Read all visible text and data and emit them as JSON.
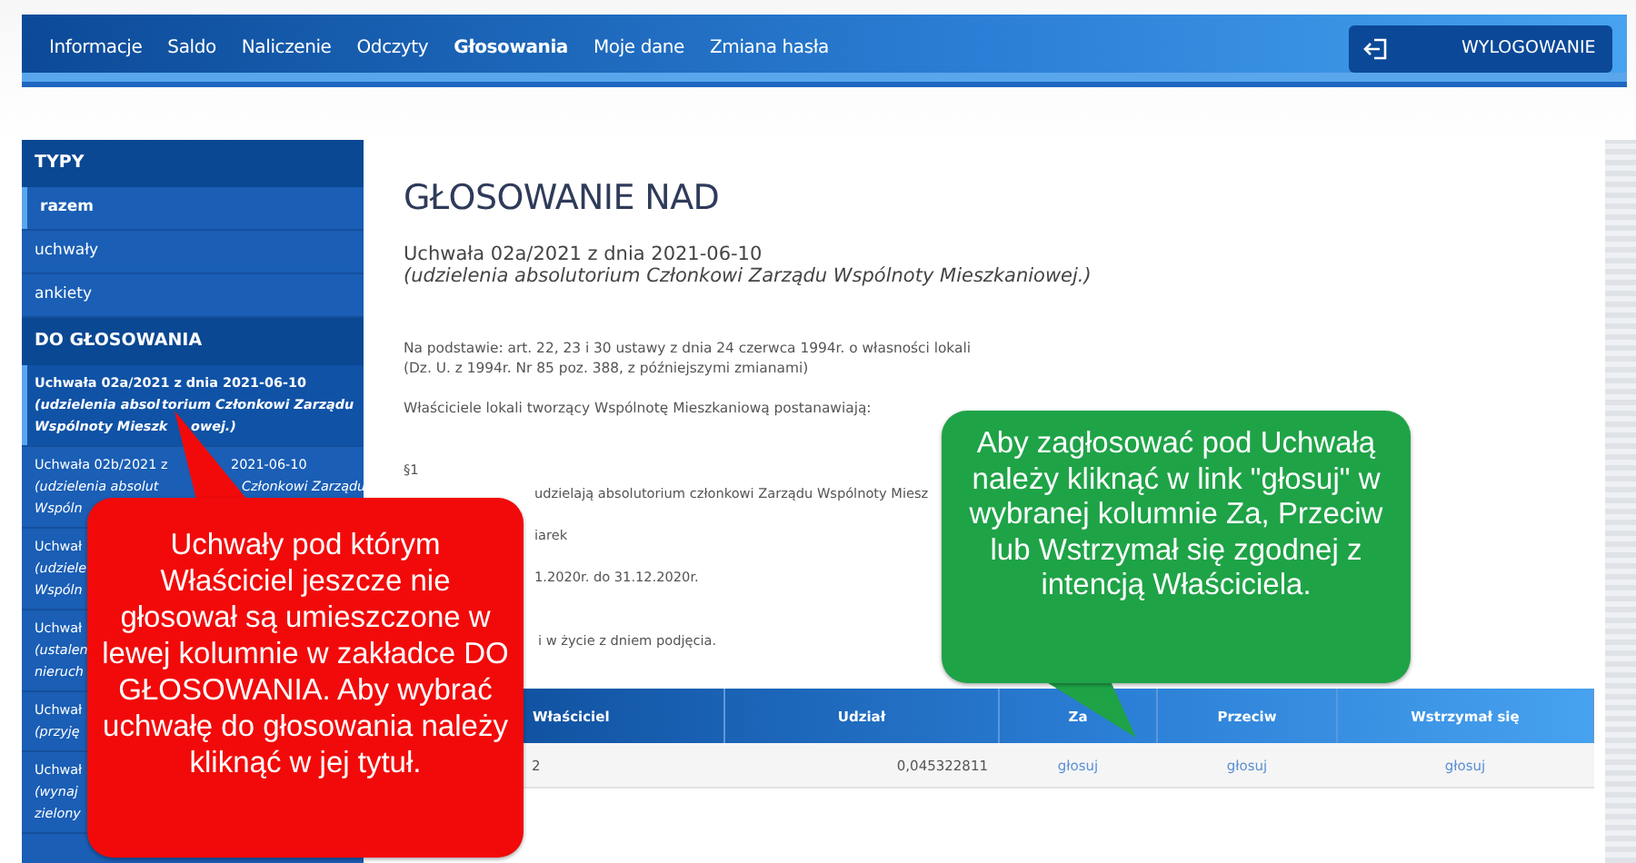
{
  "nav": {
    "items": [
      {
        "label": "Informacje",
        "selected": false
      },
      {
        "label": "Saldo",
        "selected": false
      },
      {
        "label": "Naliczenie",
        "selected": false
      },
      {
        "label": "Odczyty",
        "selected": false
      },
      {
        "label": "Głosowania",
        "selected": true
      },
      {
        "label": "Moje dane",
        "selected": false
      },
      {
        "label": "Zmiana hasła",
        "selected": false
      }
    ],
    "logout": "WYLOGOWANIE"
  },
  "sidebar": {
    "types": {
      "title": "TYPY",
      "items": [
        {
          "label": "razem",
          "selected": true
        },
        {
          "label": "uchwały",
          "selected": false
        },
        {
          "label": "ankiety",
          "selected": false
        }
      ]
    },
    "to_vote": {
      "title": "DO GŁOSOWANIA",
      "items": [
        {
          "title": [
            "Uchwała 02a/2021 z dnia 2021-06-10"
          ],
          "description": [
            [
              "(udzielenia absol",
              "torium Członkowi Zarządu"
            ],
            [
              "Wspólnoty Mieszk",
              "owej.)"
            ]
          ],
          "selected": true
        },
        {
          "title": [
            "Uchwała 02b/2021 z",
            "2021-06-10"
          ],
          "description": [
            [
              "(udzielenia absolut",
              "Członkowi Zarządu"
            ],
            [
              "Wspóln"
            ]
          ],
          "selected": false
        },
        {
          "title": [
            "Uchwał"
          ],
          "description": [
            [
              "(udziele"
            ],
            [
              "Wspóln"
            ]
          ],
          "selected": false
        },
        {
          "title": [
            "Uchwał"
          ],
          "description": [
            [
              "(ustalen"
            ],
            [
              "nieruch"
            ]
          ],
          "selected": false
        },
        {
          "title": [
            "Uchwał"
          ],
          "description": [
            [
              "(przyję"
            ]
          ],
          "selected": false
        },
        {
          "title": [
            "Uchwał"
          ],
          "description": [
            [
              "(wynaj"
            ],
            [
              "zielony"
            ]
          ],
          "selected": false
        }
      ]
    }
  },
  "main": {
    "heading": "GŁOSOWANIE NAD",
    "resolution": {
      "title": "Uchwała 02a/2021 z dnia 2021-06-10",
      "description": "(udzielenia absolutorium Członkowi Zarządu Wspólnoty Mieszkaniowej.)"
    },
    "basis": [
      "Na podstawie: art. 22, 23 i 30 ustawy z dnia 24 czerwca 1994r. o własności lokali",
      "(Dz. U. z 1994r. Nr 85 poz. 388, z późniejszymi zmianami)"
    ],
    "intro": "Właściciele lokali tworzący Wspólnotę Mieszkaniową postanawiają:",
    "clauses": [
      {
        "kind": "full",
        "text": "§1"
      },
      {
        "kind": "tail",
        "text": "udzielają absolutorium członkowi Zarządu Wspólnoty Miesz"
      },
      {
        "kind": "tail",
        "text": "iarek"
      },
      {
        "kind": "tail",
        "text": "1.2020r. do 31.12.2020r."
      },
      {
        "kind": "gap",
        "text": "i w życie z dniem podjęcia."
      }
    ],
    "table": {
      "columns": [
        "Właściciel",
        "Udział",
        "Za",
        "Przeciw",
        "Wstrzymał się"
      ],
      "rows": [
        [
          "2",
          "0,045322811",
          "głosuj",
          "głosuj",
          "głosuj"
        ]
      ]
    }
  },
  "callouts": [
    {
      "color": "#f20a0a",
      "text": "Uchwały pod którym Właściciel jeszcze nie głosował są umieszczone w lewej kolumnie w zakładce DO GŁOSOWANIA. Aby wybrać uchwałę do głosowania należy kliknąć w jej tytuł."
    },
    {
      "color": "#1fa347",
      "text": "Aby zagłosować pod Uchwałą należy kliknąć w link \"głosuj\" w wybranej kolumnie Za, Przeciw lub Wstrzymał się zgodnej z intencją Właściciela."
    }
  ]
}
